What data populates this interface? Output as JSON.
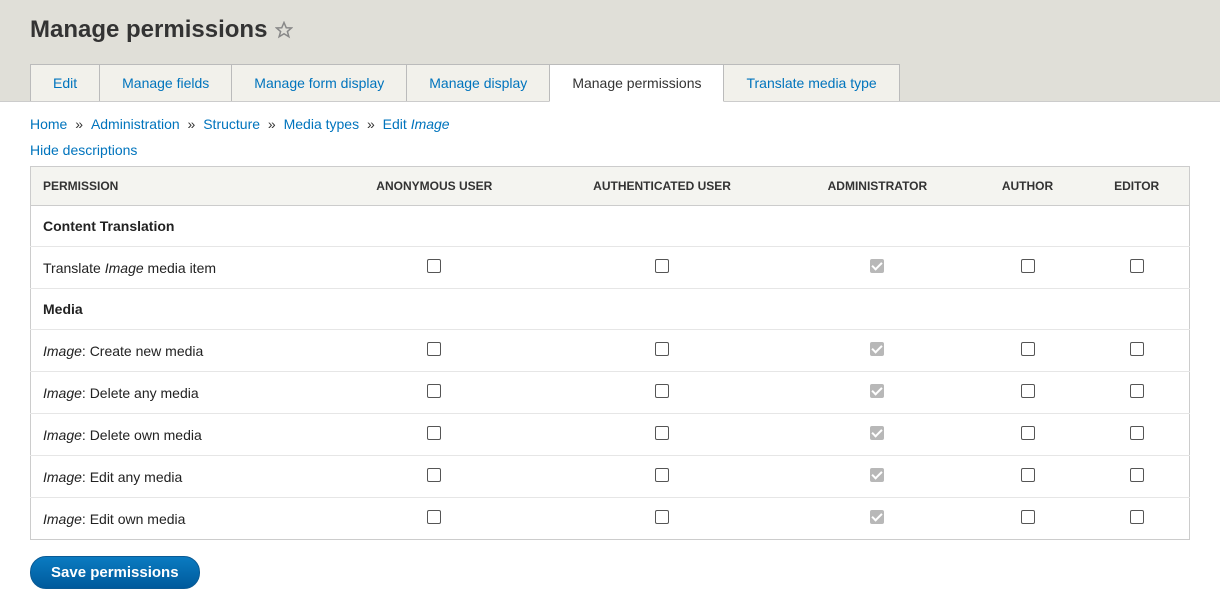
{
  "page": {
    "title": "Manage permissions"
  },
  "tabs": [
    {
      "label": "Edit",
      "active": false
    },
    {
      "label": "Manage fields",
      "active": false
    },
    {
      "label": "Manage form display",
      "active": false
    },
    {
      "label": "Manage display",
      "active": false
    },
    {
      "label": "Manage permissions",
      "active": true
    },
    {
      "label": "Translate media type",
      "active": false
    }
  ],
  "breadcrumb": {
    "items": [
      {
        "label": "Home"
      },
      {
        "label": "Administration"
      },
      {
        "label": "Structure"
      },
      {
        "label": "Media types"
      }
    ],
    "current_prefix": "Edit ",
    "current_em": "Image",
    "sep": "»"
  },
  "links": {
    "hide_descriptions": "Hide descriptions"
  },
  "table": {
    "header_permission": "Permission",
    "roles": [
      "Anonymous user",
      "Authenticated user",
      "Administrator",
      "Author",
      "Editor"
    ],
    "sections": [
      {
        "title": "Content Translation",
        "rows": [
          {
            "prefix": "Translate ",
            "em": "Image",
            "suffix": " media item",
            "cells": [
              {
                "checked": false,
                "disabled": false
              },
              {
                "checked": false,
                "disabled": false
              },
              {
                "checked": true,
                "disabled": true
              },
              {
                "checked": false,
                "disabled": false
              },
              {
                "checked": false,
                "disabled": false
              }
            ]
          }
        ]
      },
      {
        "title": "Media",
        "rows": [
          {
            "prefix": "",
            "em": "Image",
            "suffix": ": Create new media",
            "cells": [
              {
                "checked": false,
                "disabled": false
              },
              {
                "checked": false,
                "disabled": false
              },
              {
                "checked": true,
                "disabled": true
              },
              {
                "checked": false,
                "disabled": false
              },
              {
                "checked": false,
                "disabled": false
              }
            ]
          },
          {
            "prefix": "",
            "em": "Image",
            "suffix": ": Delete any media",
            "cells": [
              {
                "checked": false,
                "disabled": false
              },
              {
                "checked": false,
                "disabled": false
              },
              {
                "checked": true,
                "disabled": true
              },
              {
                "checked": false,
                "disabled": false
              },
              {
                "checked": false,
                "disabled": false
              }
            ]
          },
          {
            "prefix": "",
            "em": "Image",
            "suffix": ": Delete own media",
            "cells": [
              {
                "checked": false,
                "disabled": false
              },
              {
                "checked": false,
                "disabled": false
              },
              {
                "checked": true,
                "disabled": true
              },
              {
                "checked": false,
                "disabled": false
              },
              {
                "checked": false,
                "disabled": false
              }
            ]
          },
          {
            "prefix": "",
            "em": "Image",
            "suffix": ": Edit any media",
            "cells": [
              {
                "checked": false,
                "disabled": false
              },
              {
                "checked": false,
                "disabled": false
              },
              {
                "checked": true,
                "disabled": true
              },
              {
                "checked": false,
                "disabled": false
              },
              {
                "checked": false,
                "disabled": false
              }
            ]
          },
          {
            "prefix": "",
            "em": "Image",
            "suffix": ": Edit own media",
            "cells": [
              {
                "checked": false,
                "disabled": false
              },
              {
                "checked": false,
                "disabled": false
              },
              {
                "checked": true,
                "disabled": true
              },
              {
                "checked": false,
                "disabled": false
              },
              {
                "checked": false,
                "disabled": false
              }
            ]
          }
        ]
      }
    ]
  },
  "buttons": {
    "save": "Save permissions"
  }
}
